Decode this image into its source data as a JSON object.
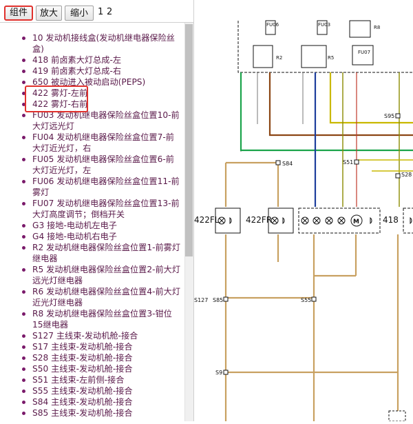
{
  "toolbar": {
    "components_label": "组件",
    "zoom_in_label": "放大",
    "zoom_out_label": "缩小",
    "pages": [
      "1",
      "2"
    ]
  },
  "components": [
    "10 发动机接线盒(发动机继电器保险丝盒)",
    "418 前卤素大灯总成-左",
    "419 前卤素大灯总成-右",
    "650 被动进入被动启动(PEPS)",
    "422 雾灯-左前",
    "422 雾灯-右前",
    "FU03 发动机继电器保险丝盒位置10-前大灯远光灯",
    "FU04 发动机继电器保险丝盒位置7-前大灯近光灯，右",
    "FU05 发动机继电器保险丝盒位置6-前大灯近光灯，左",
    "FU06 发动机继电器保险丝盒位置11-前雾灯",
    "FU07 发动机继电器保险丝盒位置13-前大灯高度调节；倒档开关",
    "G3 接地-电动机左电子",
    "G4 接地-电动机右电子",
    "R2 发动机继电器保险丝盒位置1-前雾灯继电器",
    "R5 发动机继电器保险丝盒位置2-前大灯远光灯继电器",
    "R6 发动机继电器保险丝盒位置4-前大灯近光灯继电器",
    "R8 发动机继电器保险丝盒位置3-钳位15继电器",
    "S127 主线束-发动机舱-接合",
    "S17 主线束-发动机舱-接合",
    "S28 主线束-发动机舱-接合",
    "S50 主线束-发动机舱-接合",
    "S51 主线束-左前侧-接合",
    "S55 主线束-发动机舱-接合",
    "S84 主线束-发动机舱-接合",
    "S85 主线束-发动机舱-接合"
  ],
  "diagram": {
    "relays": [
      "FU06",
      "FU03",
      "R8",
      "R2",
      "R5",
      "FU07"
    ],
    "splices": [
      "S95",
      "S84",
      "S51",
      "S28",
      "S127",
      "S85",
      "S55",
      "S9"
    ],
    "components": [
      "422FL",
      "422FR",
      "418"
    ],
    "colors": {
      "green": "#1aa34a",
      "brown": "#8b4513",
      "blue": "#1c3d9c",
      "yellow": "#c9b800",
      "tan": "#c8a060",
      "red": "#c0392b",
      "olive": "#8a8a00"
    }
  }
}
